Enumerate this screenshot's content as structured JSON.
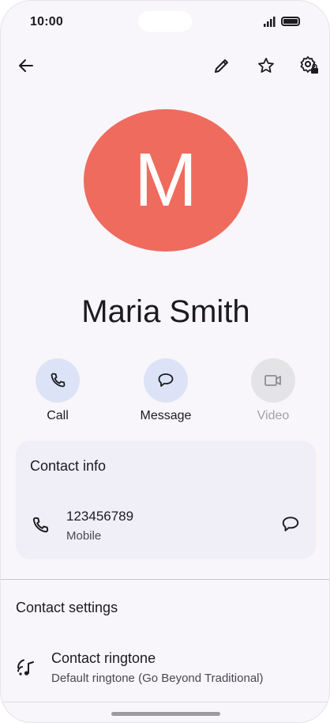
{
  "status_bar": {
    "time": "10:00"
  },
  "toolbar": {
    "back_icon": "arrow-back-icon",
    "edit_icon": "pencil-icon",
    "favorite_icon": "star-icon",
    "settings_icon": "settings-lock-icon"
  },
  "contact": {
    "avatar_letter": "M",
    "avatar_color": "#ef6b5e",
    "name": "Maria Smith"
  },
  "actions": [
    {
      "label": "Call",
      "icon": "phone-icon",
      "enabled": true
    },
    {
      "label": "Message",
      "icon": "chat-bubble-icon",
      "enabled": true
    },
    {
      "label": "Video",
      "icon": "video-camera-icon",
      "enabled": false
    }
  ],
  "contact_info": {
    "title": "Contact info",
    "number": "123456789",
    "type": "Mobile"
  },
  "contact_settings": {
    "title": "Contact settings",
    "ringtone": {
      "title": "Contact ringtone",
      "value": "Default ringtone (Go Beyond Traditional)"
    }
  },
  "colors": {
    "action_circle": "#dde3f6",
    "card_background": "#f0eef6",
    "page_background": "#f8f6fb"
  }
}
